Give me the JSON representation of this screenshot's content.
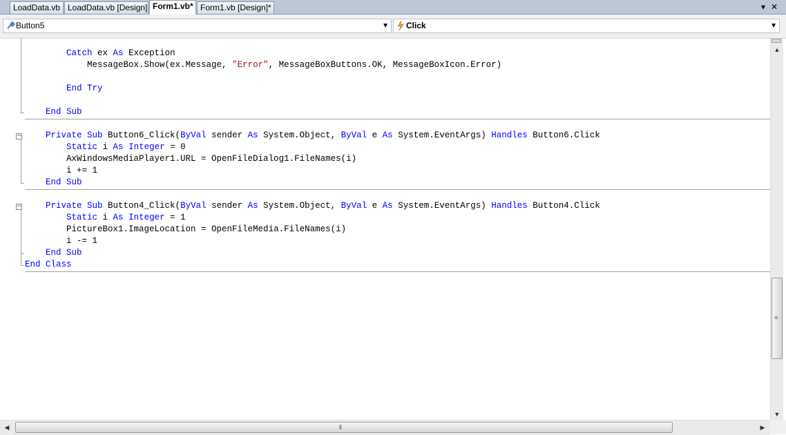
{
  "tabs": [
    {
      "label": "LoadData.vb",
      "active": false
    },
    {
      "label": "LoadData.vb [Design]",
      "active": false
    },
    {
      "label": "Form1.vb*",
      "active": true
    },
    {
      "label": "Form1.vb [Design]*",
      "active": false
    }
  ],
  "tab_controls": {
    "dropdown_icon": "▾",
    "close_icon": "✕"
  },
  "navbar": {
    "class_combo": {
      "icon": "class-member-icon",
      "value": "Button5"
    },
    "method_combo": {
      "icon": "lightning-event-icon",
      "value": "Click"
    }
  },
  "code": {
    "catch_line": {
      "kw1": "Catch",
      "t1": " ex ",
      "kw2": "As",
      "t2": " Exception"
    },
    "msgbox_line": {
      "t1": "MessageBox.Show(ex.Message, ",
      "str": "\"Error\"",
      "t2": ", MessageBoxButtons.OK, MessageBoxIcon.Error)"
    },
    "end_try": "End Try",
    "end_sub_1": "End Sub",
    "button6": {
      "sub_line": {
        "kw1": "Private Sub",
        "t1": " Button6_Click(",
        "kw2": "ByVal",
        "t2": " sender ",
        "kw3": "As",
        "t3": " System.Object, ",
        "kw4": "ByVal",
        "t4": " e ",
        "kw5": "As",
        "t5": " System.EventArgs) ",
        "kw6": "Handles",
        "t6": " Button6.Click"
      },
      "static_line": {
        "kw1": "Static",
        "t1": " i ",
        "kw2": "As",
        "t2": " ",
        "kw3": "Integer",
        "t3": " = 0"
      },
      "url_line": "AxWindowsMediaPlayer1.URL = OpenFileDialog1.FileNames(i)",
      "inc_line": "i += 1",
      "end_sub": "End Sub"
    },
    "button4": {
      "sub_line": {
        "kw1": "Private Sub",
        "t1": " Button4_Click(",
        "kw2": "ByVal",
        "t2": " sender ",
        "kw3": "As",
        "t3": " System.Object, ",
        "kw4": "ByVal",
        "t4": " e ",
        "kw5": "As",
        "t5": " System.EventArgs) ",
        "kw6": "Handles",
        "t6": " Button4.Click"
      },
      "static_line": {
        "kw1": "Static",
        "t1": " i ",
        "kw2": "As",
        "t2": " ",
        "kw3": "Integer",
        "t3": " = 1"
      },
      "picture_line": "PictureBox1.ImageLocation = OpenFileMedia.FileNames(i)",
      "dec_line": "i -= 1",
      "end_sub": "End Sub"
    },
    "end_class": "End Class"
  },
  "scrollbars": {
    "up_arrow": "▲",
    "down_arrow": "▼",
    "left_arrow": "◀",
    "right_arrow": "▶",
    "v_grip": "≡",
    "h_grip": "⦀"
  }
}
